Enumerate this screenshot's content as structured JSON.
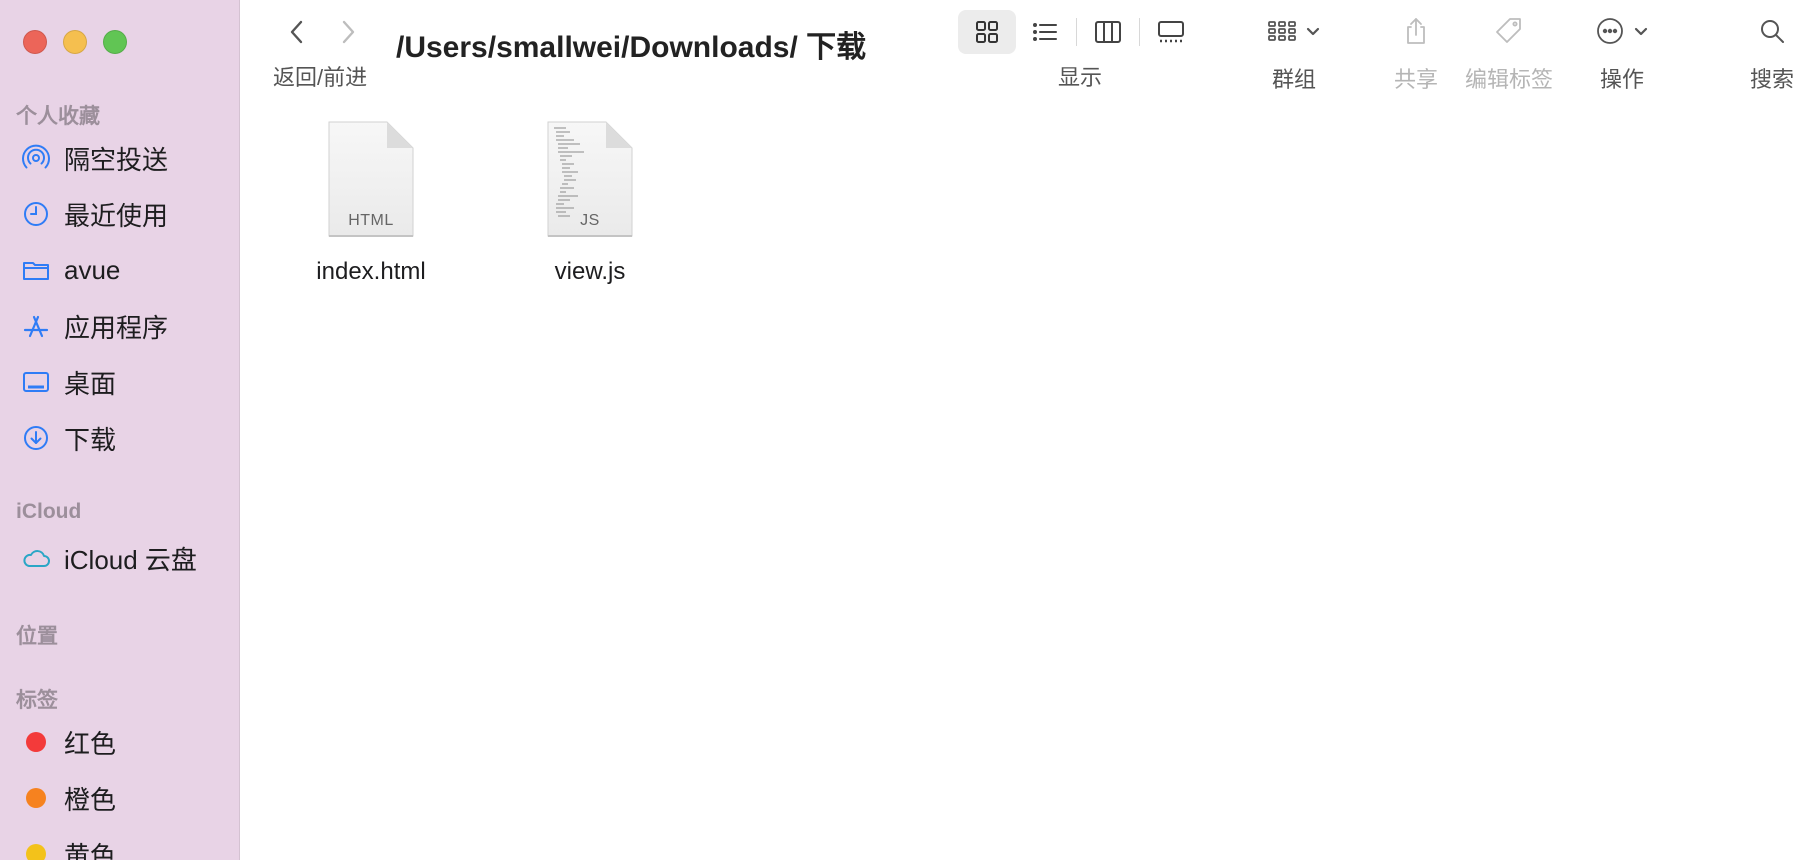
{
  "sidebar": {
    "sections": {
      "favorites": "个人收藏",
      "icloud": "iCloud",
      "locations": "位置",
      "tags": "标签"
    },
    "favorites": [
      {
        "label": "隔空投送",
        "icon": "airdrop-icon"
      },
      {
        "label": "最近使用",
        "icon": "clock-icon"
      },
      {
        "label": "avue",
        "icon": "folder-icon"
      },
      {
        "label": "应用程序",
        "icon": "applications-icon"
      },
      {
        "label": "桌面",
        "icon": "desktop-icon"
      },
      {
        "label": "下载",
        "icon": "download-icon"
      }
    ],
    "icloud_items": [
      {
        "label": "iCloud 云盘",
        "icon": "cloud-icon"
      }
    ],
    "tags": [
      {
        "label": "红色",
        "color": "#f33a3a"
      },
      {
        "label": "橙色",
        "color": "#f6821f"
      },
      {
        "label": "黄色",
        "color": "#f3c21a"
      }
    ]
  },
  "toolbar": {
    "nav_label": "返回/前进",
    "path_title": "/Users/smallwei/Downloads/ 下载",
    "view_label": "显示",
    "group_label": "群组",
    "share_label": "共享",
    "edit_tags_label": "编辑标签",
    "action_label": "操作",
    "search_label": "搜索"
  },
  "files": [
    {
      "name": "index.html",
      "ext": "HTML"
    },
    {
      "name": "view.js",
      "ext": "JS"
    }
  ],
  "colors": {
    "sidebar_bg": "#e8d3e6",
    "accent_blue": "#2f7cf6"
  }
}
